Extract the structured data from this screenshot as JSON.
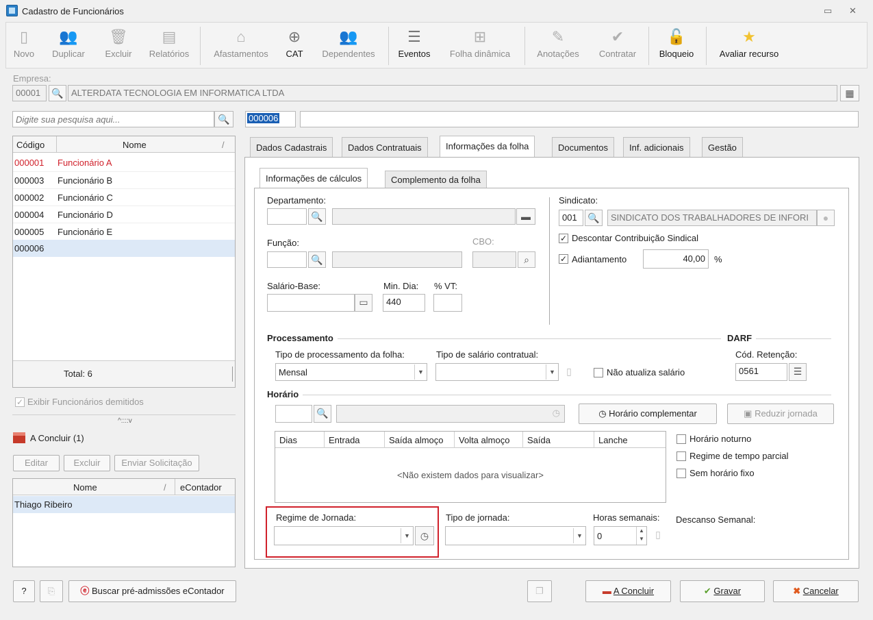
{
  "window": {
    "title": "Cadastro de Funcionários"
  },
  "toolbar": {
    "novo": "Novo",
    "duplicar": "Duplicar",
    "excluir": "Excluir",
    "relatorios": "Relatórios",
    "afastamentos": "Afastamentos",
    "cat": "CAT",
    "dependentes": "Dependentes",
    "eventos": "Eventos",
    "folha_dinamica": "Folha dinâmica",
    "anotacoes": "Anotações",
    "contratar": "Contratar",
    "bloqueio": "Bloqueio",
    "avaliar": "Avaliar recurso"
  },
  "empresa": {
    "label": "Empresa:",
    "code": "00001",
    "name": "ALTERDATA TECNOLOGIA EM INFORMATICA LTDA"
  },
  "search": {
    "placeholder": "Digite sua pesquisa aqui..."
  },
  "current": {
    "code": "000006",
    "name": ""
  },
  "employees": {
    "col_code": "Código",
    "col_name": "Nome",
    "sort_mark": "/",
    "rows": [
      {
        "code": "000001",
        "name": "Funcionário A"
      },
      {
        "code": "000003",
        "name": "Funcionário B"
      },
      {
        "code": "000002",
        "name": "Funcionário C"
      },
      {
        "code": "000004",
        "name": "Funcionário D"
      },
      {
        "code": "000005",
        "name": "Funcionário E"
      },
      {
        "code": "000006",
        "name": ""
      }
    ],
    "total": "Total: 6"
  },
  "exibir_demitidos": "Exibir Funcionários demitidos",
  "splitter": "^::::v",
  "a_concluir": {
    "title": "A Concluir (1)",
    "editar": "Editar",
    "excluir": "Excluir",
    "enviar": "Enviar Solicitação",
    "col_nome": "Nome",
    "sort_mark": "/",
    "col_econtador": "eContador",
    "rows": [
      {
        "nome": "Thiago Ribeiro",
        "econtador": ""
      }
    ]
  },
  "tabs": [
    "Dados Cadastrais",
    "Dados Contratuais",
    "Informações da folha",
    "Documentos",
    "Inf. adicionais",
    "Gestão"
  ],
  "subtabs": [
    "Informações de cálculos",
    "Complemento da folha"
  ],
  "form": {
    "departamento": "Departamento:",
    "funcao": "Função:",
    "cbo": "CBO:",
    "salario_base": "Salário-Base:",
    "min_dia": "Min. Dia:",
    "min_dia_value": "440",
    "vt": "% VT:",
    "sindicato": "Sindicato:",
    "sindicato_code": "001",
    "sindicato_name": "SINDICATO DOS TRABALHADORES DE INFORI",
    "descontar": "Descontar Contribuição Sindical",
    "adiantamento": "Adiantamento",
    "adiantamento_value": "40,00",
    "pct": "%",
    "processamento": "Processamento",
    "darf": "DARF",
    "tipo_proc": "Tipo de processamento da folha:",
    "tipo_proc_value": "Mensal",
    "tipo_salario": "Tipo de salário contratual:",
    "nao_atualiza": "Não atualiza salário",
    "cod_retencao": "Cód. Retenção:",
    "cod_retencao_value": "0561",
    "horario": "Horário",
    "horario_comp": "Horário complementar",
    "reduzir": "Reduzir jornada",
    "grid_cols": [
      "Dias",
      "Entrada",
      "Saída almoço",
      "Volta almoço",
      "Saída",
      "Lanche"
    ],
    "grid_empty": "<Não existem dados para visualizar>",
    "horario_noturno": "Horário noturno",
    "regime_parcial": "Regime de tempo parcial",
    "sem_horario": "Sem horário fixo",
    "regime_jornada": "Regime de Jornada:",
    "tipo_jornada": "Tipo de jornada:",
    "horas_semanais": "Horas semanais:",
    "horas_value": "0",
    "descanso": "Descanso Semanal:"
  },
  "bottom": {
    "help": "?",
    "buscar": "Buscar pré-admissões eContador",
    "a_concluir": "A Concluir",
    "gravar": "Gravar",
    "cancelar": "Cancelar"
  },
  "colors": {
    "accent": "#2a6fc9",
    "highlight": "#dde9f7",
    "red": "#d0202a",
    "selection": "#1a5fb4"
  }
}
